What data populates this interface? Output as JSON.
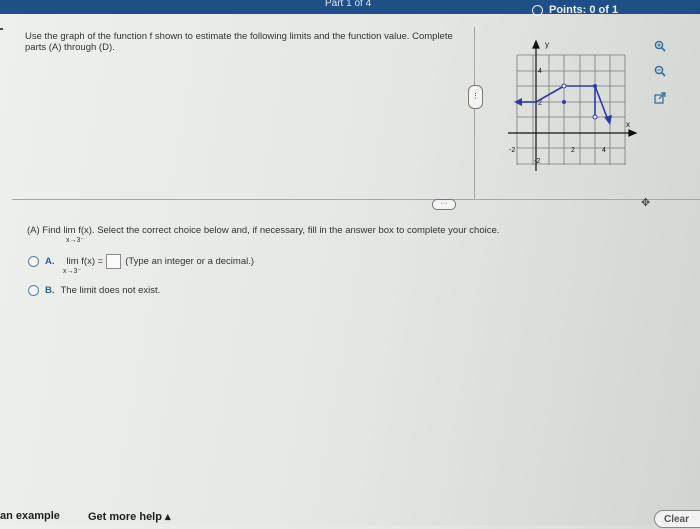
{
  "header": {
    "part": "Part 1 of 4",
    "points": "Points: 0 of 1"
  },
  "instructions": "Use the graph of the function f shown to estimate the following limits and the function value. Complete parts (A) through (D).",
  "graph": {
    "x_axis_label": "x",
    "y_axis_label": "y",
    "x_ticks": [
      "-2",
      "2",
      "4"
    ],
    "y_ticks": [
      "4",
      "2",
      "-2"
    ]
  },
  "question": {
    "text": "(A) Find  lim f(x). Select the correct choice below and, if necessary, fill in the answer box to complete your choice.",
    "limit_subscript": "x→3⁻"
  },
  "choices": {
    "a": {
      "letter": "A.",
      "prefix": "lim f(x) =",
      "subscript": "x→3⁻",
      "hint": "(Type an integer or a decimal.)",
      "answer_value": ""
    },
    "b": {
      "letter": "B.",
      "text": "The limit does not exist."
    }
  },
  "footer": {
    "example": "an example",
    "help": "Get more help ▴",
    "clear": "Clear"
  },
  "icons": {
    "zoom_in": "zoom-in-icon",
    "zoom_out": "zoom-out-icon",
    "popout": "popout-icon",
    "move": "move-icon"
  },
  "colors": {
    "header": "#1f4f86",
    "graph_line": "#2e3aa8"
  }
}
